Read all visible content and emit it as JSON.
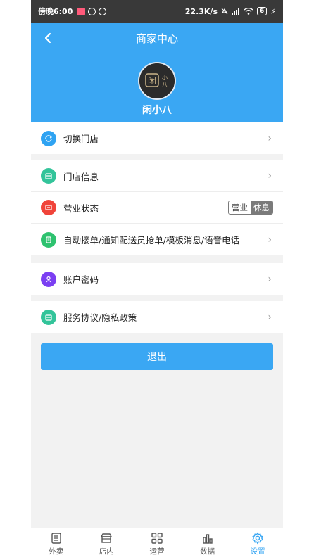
{
  "status_bar": {
    "time": "傍晚6:00",
    "net_speed": "22.3K/s",
    "battery": "6"
  },
  "header": {
    "title": "商家中心",
    "store_name": "闲小八",
    "avatar_text": "闲八"
  },
  "groups": {
    "switch": {
      "label": "切换门店",
      "icon": "switch-icon",
      "color": "#2fa3f2"
    },
    "store_info": {
      "label": "门店信息",
      "icon": "store-icon",
      "color": "#33c49a"
    },
    "business_status": {
      "label": "营业状态",
      "icon": "status-icon",
      "color": "#f0443a",
      "toggle_on": "营业",
      "toggle_off": "休息"
    },
    "auto_order": {
      "label": "自动接单/通知配送员抢单/模板消息/语音电话",
      "icon": "document-icon",
      "color": "#2ec26f"
    },
    "account": {
      "label": "账户密码",
      "icon": "user-icon",
      "color": "#7b3ff2"
    },
    "policy": {
      "label": "服务协议/隐私政策",
      "icon": "agreement-icon",
      "color": "#33c49a"
    }
  },
  "logout_label": "退出",
  "tabs": [
    {
      "label": "外卖",
      "icon": "list-icon",
      "active": false
    },
    {
      "label": "店内",
      "icon": "shop-icon",
      "active": false
    },
    {
      "label": "运营",
      "icon": "grid-icon",
      "active": false
    },
    {
      "label": "数据",
      "icon": "bar-chart-icon",
      "active": false
    },
    {
      "label": "设置",
      "icon": "gear-icon",
      "active": true
    }
  ],
  "colors": {
    "primary": "#3aa7f3",
    "status_bar": "#393939",
    "background": "#f2f2f2"
  }
}
